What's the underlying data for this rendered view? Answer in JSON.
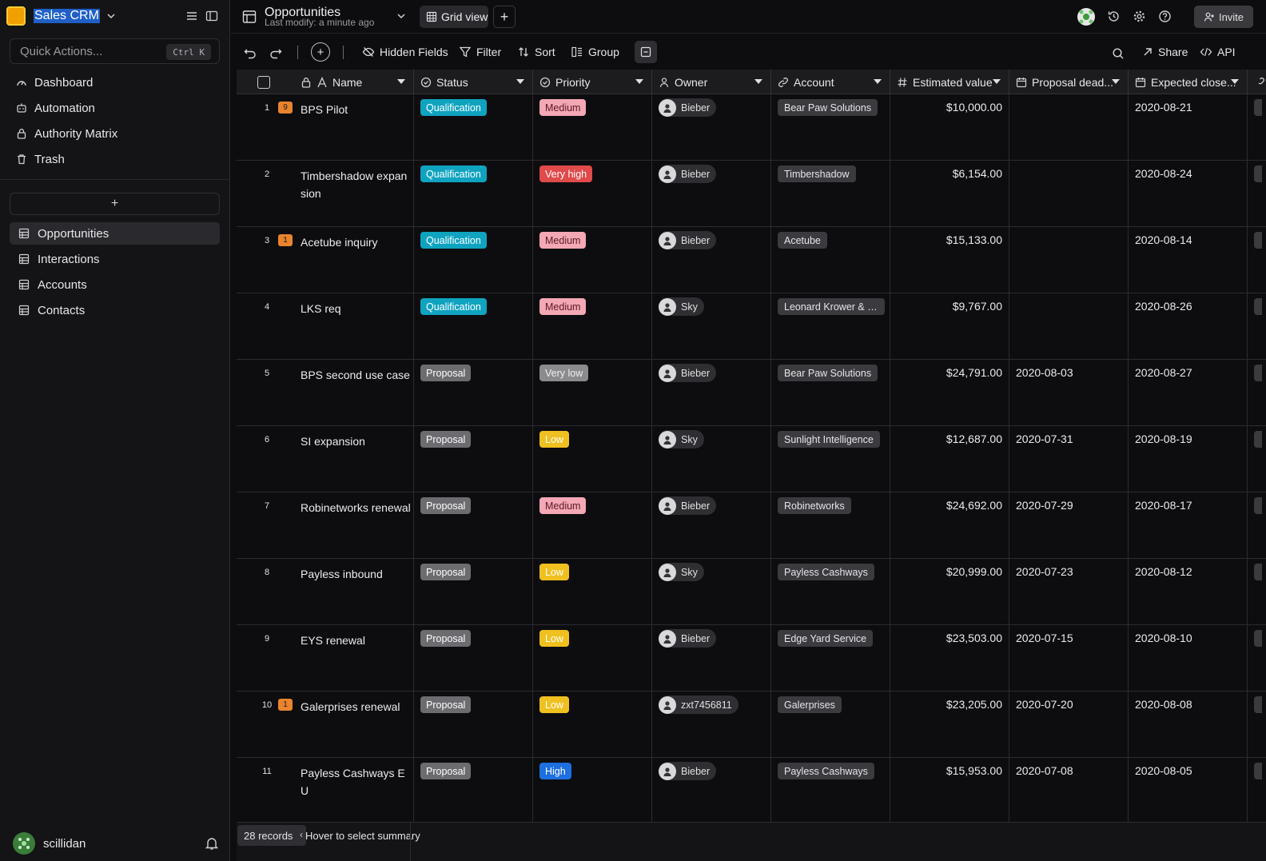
{
  "space": {
    "name": "Sales CRM"
  },
  "quick_actions": {
    "placeholder": "Quick Actions...",
    "shortcut": "Ctrl K"
  },
  "nav": [
    {
      "label": "Dashboard",
      "icon": "dashboard-icon"
    },
    {
      "label": "Automation",
      "icon": "robot-icon"
    },
    {
      "label": "Authority Matrix",
      "icon": "lock-icon"
    },
    {
      "label": "Trash",
      "icon": "trash-icon"
    }
  ],
  "add_node_label": "+",
  "nodes": [
    {
      "label": "Opportunities",
      "active": true
    },
    {
      "label": "Interactions",
      "active": false
    },
    {
      "label": "Accounts",
      "active": false
    },
    {
      "label": "Contacts",
      "active": false
    }
  ],
  "footer": {
    "user": "scillidan"
  },
  "topbar": {
    "title": "Opportunities",
    "subtitle": "Last modify: a minute ago",
    "view_name": "Grid view",
    "add_view": "+",
    "invite": "Invite"
  },
  "toolbar": {
    "add": "+",
    "hidden_fields": "Hidden Fields",
    "filter": "Filter",
    "sort": "Sort",
    "group": "Group",
    "share": "Share",
    "api": "API"
  },
  "columns": [
    "Name",
    "Status",
    "Priority",
    "Owner",
    "Account",
    "Estimated value",
    "Proposal dead...",
    "Expected close..."
  ],
  "colors": {
    "qualification": "#0fa3c0",
    "proposal": "#6b6b70",
    "medium": "#f4a7b5",
    "very_high": "#e04a4a",
    "very_low": "#8a8a8f",
    "low": "#f0c020",
    "high": "#1e6fe0",
    "comment_badge": "#e9842d"
  },
  "rows": [
    {
      "num": "1",
      "badge": "9",
      "name": "BPS Pilot",
      "status": "Qualification",
      "priority": "Medium",
      "owner": "Bieber",
      "account": "Bear Paw Solutions",
      "value": "$10,000.00",
      "proposal_deadline": "",
      "expected_close": "2020-08-21"
    },
    {
      "num": "2",
      "badge": "",
      "name": "Timbershadow expansion",
      "status": "Qualification",
      "priority": "Very high",
      "owner": "Bieber",
      "account": "Timbershadow",
      "value": "$6,154.00",
      "proposal_deadline": "",
      "expected_close": "2020-08-24"
    },
    {
      "num": "3",
      "badge": "1",
      "name": "Acetube inquiry",
      "status": "Qualification",
      "priority": "Medium",
      "owner": "Bieber",
      "account": "Acetube",
      "value": "$15,133.00",
      "proposal_deadline": "",
      "expected_close": "2020-08-14"
    },
    {
      "num": "4",
      "badge": "",
      "name": "LKS req",
      "status": "Qualification",
      "priority": "Medium",
      "owner": "Sky",
      "account": "Leonard Krower & So...",
      "value": "$9,767.00",
      "proposal_deadline": "",
      "expected_close": "2020-08-26"
    },
    {
      "num": "5",
      "badge": "",
      "name": "BPS second use case",
      "status": "Proposal",
      "priority": "Very low",
      "owner": "Bieber",
      "account": "Bear Paw Solutions",
      "value": "$24,791.00",
      "proposal_deadline": "2020-08-03",
      "expected_close": "2020-08-27"
    },
    {
      "num": "6",
      "badge": "",
      "name": "SI expansion",
      "status": "Proposal",
      "priority": "Low",
      "owner": "Sky",
      "account": "Sunlight Intelligence",
      "value": "$12,687.00",
      "proposal_deadline": "2020-07-31",
      "expected_close": "2020-08-19"
    },
    {
      "num": "7",
      "badge": "",
      "name": "Robinetworks renewal",
      "status": "Proposal",
      "priority": "Medium",
      "owner": "Bieber",
      "account": "Robinetworks",
      "value": "$24,692.00",
      "proposal_deadline": "2020-07-29",
      "expected_close": "2020-08-17"
    },
    {
      "num": "8",
      "badge": "",
      "name": "Payless inbound",
      "status": "Proposal",
      "priority": "Low",
      "owner": "Sky",
      "account": "Payless Cashways",
      "value": "$20,999.00",
      "proposal_deadline": "2020-07-23",
      "expected_close": "2020-08-12"
    },
    {
      "num": "9",
      "badge": "",
      "name": "EYS renewal",
      "status": "Proposal",
      "priority": "Low",
      "owner": "Bieber",
      "account": "Edge Yard Service",
      "value": "$23,503.00",
      "proposal_deadline": "2020-07-15",
      "expected_close": "2020-08-10"
    },
    {
      "num": "10",
      "badge": "1",
      "name": "Galerprises renewal",
      "status": "Proposal",
      "priority": "Low",
      "owner": "zxt7456811",
      "account": "Galerprises",
      "value": "$23,205.00",
      "proposal_deadline": "2020-07-20",
      "expected_close": "2020-08-08"
    },
    {
      "num": "11",
      "badge": "",
      "name": "Payless Cashways EU",
      "status": "Proposal",
      "priority": "High",
      "owner": "Bieber",
      "account": "Payless Cashways",
      "value": "$15,953.00",
      "proposal_deadline": "2020-07-08",
      "expected_close": "2020-08-05"
    }
  ],
  "footer_bar": {
    "records": "28 records",
    "summary_hint": "Hover to select summary"
  }
}
